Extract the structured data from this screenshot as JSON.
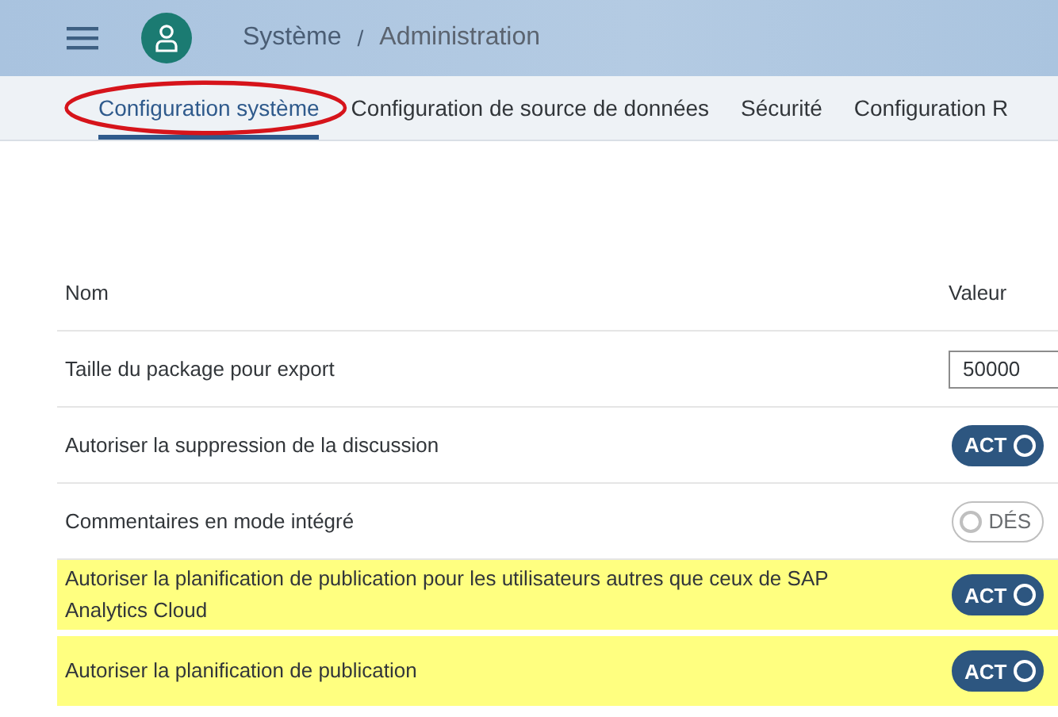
{
  "breadcrumb": [
    "Système",
    "Administration"
  ],
  "breadcrumb_separator": "/",
  "tabs": [
    {
      "label": "Configuration système",
      "selected": true,
      "annotated": true
    },
    {
      "label": "Configuration de source de données",
      "selected": false,
      "annotated": false
    },
    {
      "label": "Sécurité",
      "selected": false,
      "annotated": false
    },
    {
      "label": "Configuration R",
      "selected": false,
      "annotated": false
    }
  ],
  "table": {
    "columns": [
      "Nom",
      "Valeur"
    ],
    "rows": [
      {
        "name": "Taille du package pour export",
        "kind": "input",
        "value": "50000",
        "highlighted": false
      },
      {
        "name": "Autoriser la suppression de la discussion",
        "kind": "toggle",
        "on": true,
        "toggle_text": "ACT",
        "highlighted": false
      },
      {
        "name": "Commentaires en mode intégré",
        "kind": "toggle",
        "on": false,
        "toggle_text": "DÉS",
        "highlighted": false
      },
      {
        "name": "Autoriser la planification de publication pour les utilisateurs autres que ceux de SAP Analytics Cloud",
        "kind": "toggle",
        "on": true,
        "toggle_text": "ACT",
        "highlighted": true
      },
      {
        "name": "Autoriser la planification de publication",
        "kind": "toggle",
        "on": true,
        "toggle_text": "ACT",
        "highlighted": true
      }
    ]
  }
}
